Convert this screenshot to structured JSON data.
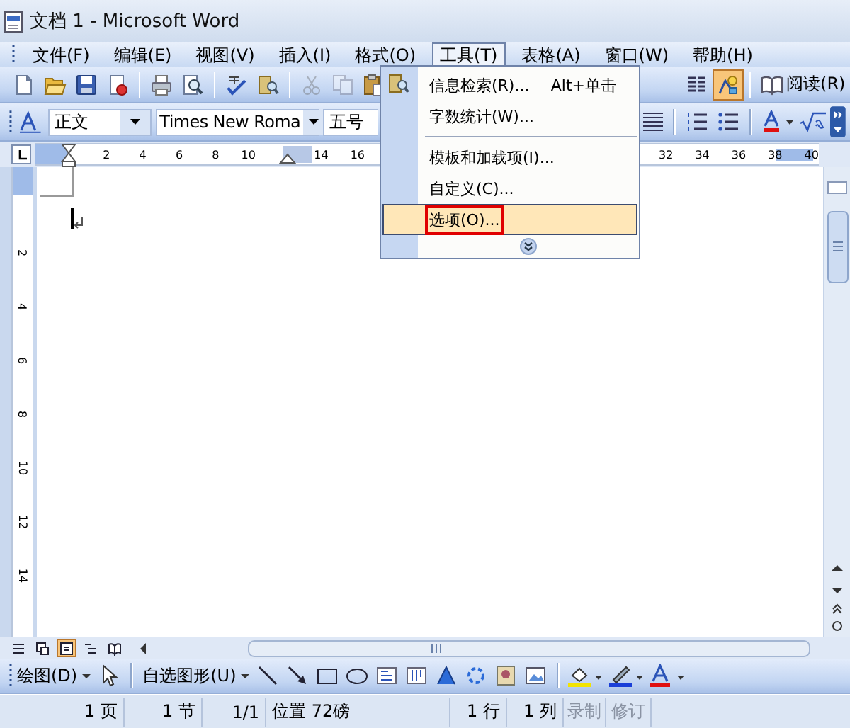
{
  "window": {
    "title": "文档 1 - Microsoft Word"
  },
  "menu_bar": [
    {
      "label": "文件(F)",
      "selected": false
    },
    {
      "label": "编辑(E)",
      "selected": false
    },
    {
      "label": "视图(V)",
      "selected": false
    },
    {
      "label": "插入(I)",
      "selected": false
    },
    {
      "label": "格式(O)",
      "selected": false
    },
    {
      "label": "工具(T)",
      "selected": true
    },
    {
      "label": "表格(A)",
      "selected": false
    },
    {
      "label": "窗口(W)",
      "selected": false
    },
    {
      "label": "帮助(H)",
      "selected": false
    }
  ],
  "standard_toolbar": {
    "buttons": [
      {
        "kind": "new",
        "on": false,
        "disabled": false
      },
      {
        "kind": "open",
        "on": false,
        "disabled": false
      },
      {
        "kind": "save",
        "on": false,
        "disabled": false
      },
      {
        "kind": "permission",
        "on": false,
        "disabled": false
      },
      {
        "kind": "print",
        "on": false,
        "disabled": false
      },
      {
        "kind": "preview",
        "on": false,
        "disabled": false
      },
      {
        "kind": "spelling",
        "on": false,
        "disabled": false
      },
      {
        "kind": "research",
        "on": false,
        "disabled": false
      },
      {
        "kind": "cut",
        "on": false,
        "disabled": true
      },
      {
        "kind": "copy",
        "on": false,
        "disabled": true
      },
      {
        "kind": "paste",
        "on": false,
        "disabled": false
      },
      {
        "kind": "columns",
        "on": false,
        "disabled": false
      },
      {
        "kind": "drawing",
        "on": true,
        "disabled": false
      }
    ],
    "read_button": "阅读(R)"
  },
  "formatting_toolbar": {
    "style": "正文",
    "font": "Times New Roma",
    "size": "五号"
  },
  "ruler": {
    "left_ticks": [
      "2",
      "4",
      "6",
      "8",
      "10",
      "14",
      "16"
    ],
    "right_ticks": [
      "32",
      "34",
      "36",
      "38",
      "40"
    ]
  },
  "vertical_ruler": [
    "2",
    "4",
    "6",
    "8",
    "10",
    "12",
    "14"
  ],
  "tools_menu": [
    {
      "kind": "item",
      "label": "信息检索(R)...",
      "shortcut": "Alt+单击",
      "selected": false
    },
    {
      "kind": "item",
      "label": "字数统计(W)...",
      "selected": false
    },
    {
      "kind": "separator"
    },
    {
      "kind": "item",
      "label": "模板和加载项(I)...",
      "selected": false
    },
    {
      "kind": "item",
      "label": "自定义(C)...",
      "selected": false
    },
    {
      "kind": "item",
      "label": "选项(O)...",
      "selected": true
    }
  ],
  "view_buttons": [
    {
      "kind": "normal",
      "selected": false
    },
    {
      "kind": "web",
      "selected": false
    },
    {
      "kind": "print",
      "selected": true
    },
    {
      "kind": "outline",
      "selected": false
    },
    {
      "kind": "reading",
      "selected": false
    }
  ],
  "drawing_toolbar": {
    "draw_menu": "绘图(D)",
    "autoshapes_menu": "自选图形(U)"
  },
  "status_bar": [
    {
      "text": "1 页",
      "disabled": false
    },
    {
      "text": "1 节",
      "disabled": false
    },
    {
      "text": "1/1",
      "disabled": false
    },
    {
      "text": "位置 72磅",
      "disabled": false
    },
    {
      "text": "1 行",
      "disabled": false
    },
    {
      "text": "1 列",
      "disabled": false
    },
    {
      "text": "录制",
      "disabled": true
    },
    {
      "text": "修订",
      "disabled": true
    }
  ]
}
